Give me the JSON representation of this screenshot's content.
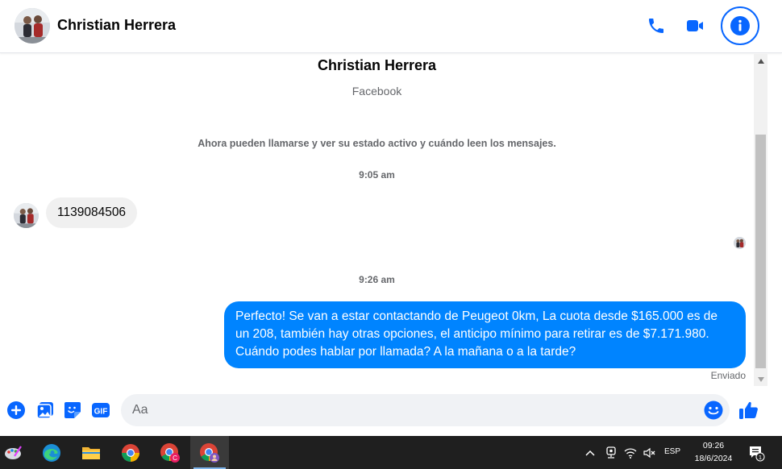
{
  "header": {
    "contact_name": "Christian Herrera"
  },
  "chat": {
    "contact_name": "Christian Herrera",
    "contact_subtitle": "Facebook",
    "system_message": "Ahora pueden llamarse y ver su estado activo y cuándo leen los mensajes.",
    "messages": [
      {
        "time": "9:05 am",
        "direction": "incoming",
        "text": "1139084506"
      },
      {
        "time": "9:26 am",
        "direction": "outgoing",
        "text": "Perfecto!  Se van a estar contactando de Peugeot 0km, La cuota desde $165.000 es de un 208, también hay otras opciones, el anticipo mínimo para retirar es de $7.171.980. Cuándo podes hablar por llamada? A la mañana o a la tarde?"
      }
    ],
    "status": "Enviado"
  },
  "composer": {
    "placeholder": "Aa"
  },
  "taskbar": {
    "language": "ESP",
    "time": "09:26",
    "date": "18/6/2024",
    "notification_count": "1"
  },
  "colors": {
    "accent": "#0866ff",
    "outgoing_bubble": "#0084ff",
    "incoming_bubble": "#f0f0f0",
    "taskbar": "#1f1f1f"
  }
}
